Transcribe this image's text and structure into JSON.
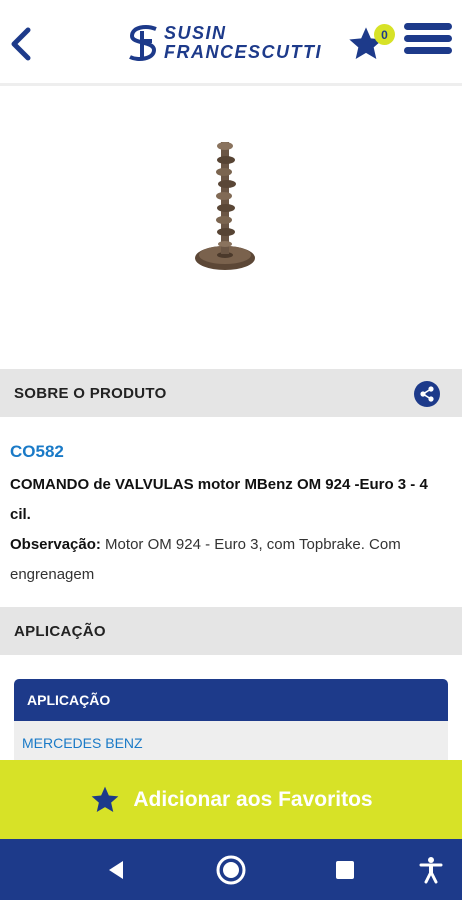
{
  "header": {
    "logo_line1": "SUSIN",
    "logo_line2": "FRANCESCUTTI",
    "favorites_count": "0",
    "brand_color": "#1d3a8a",
    "accent_color": "#d7e227"
  },
  "product": {
    "section_title": "SOBRE O PRODUTO",
    "code": "CO582",
    "name": "COMANDO de VALVULAS motor MBenz OM 924 -Euro 3 - 4 cil.",
    "observation_label": "Observação:",
    "observation_text": " Motor OM 924 - Euro 3, com Topbrake. Com engrenagem"
  },
  "application": {
    "section_title": "APLICAÇÃO",
    "table_header": "APLICAÇÃO",
    "rows": [
      "MERCEDES BENZ"
    ]
  },
  "actions": {
    "add_favorites_label": "Adicionar aos Favoritos"
  },
  "icons": {
    "back": "chevron-left-icon",
    "favorites": "star-icon",
    "menu": "hamburger-icon",
    "share": "share-icon",
    "nav_back": "triangle-back-icon",
    "nav_home": "circle-home-icon",
    "nav_recent": "square-recent-icon",
    "nav_accessibility": "accessibility-icon"
  }
}
